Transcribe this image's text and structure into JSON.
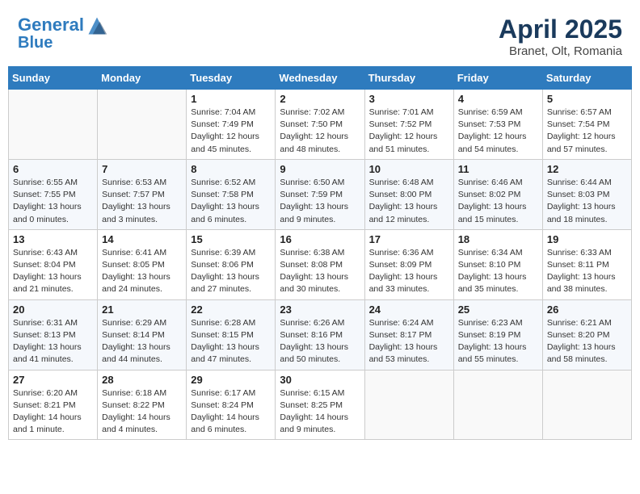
{
  "header": {
    "logo_line1": "General",
    "logo_line2": "Blue",
    "title": "April 2025",
    "subtitle": "Branet, Olt, Romania"
  },
  "days_of_week": [
    "Sunday",
    "Monday",
    "Tuesday",
    "Wednesday",
    "Thursday",
    "Friday",
    "Saturday"
  ],
  "weeks": [
    [
      {
        "day": "",
        "info": ""
      },
      {
        "day": "",
        "info": ""
      },
      {
        "day": "1",
        "info": "Sunrise: 7:04 AM\nSunset: 7:49 PM\nDaylight: 12 hours and 45 minutes."
      },
      {
        "day": "2",
        "info": "Sunrise: 7:02 AM\nSunset: 7:50 PM\nDaylight: 12 hours and 48 minutes."
      },
      {
        "day": "3",
        "info": "Sunrise: 7:01 AM\nSunset: 7:52 PM\nDaylight: 12 hours and 51 minutes."
      },
      {
        "day": "4",
        "info": "Sunrise: 6:59 AM\nSunset: 7:53 PM\nDaylight: 12 hours and 54 minutes."
      },
      {
        "day": "5",
        "info": "Sunrise: 6:57 AM\nSunset: 7:54 PM\nDaylight: 12 hours and 57 minutes."
      }
    ],
    [
      {
        "day": "6",
        "info": "Sunrise: 6:55 AM\nSunset: 7:55 PM\nDaylight: 13 hours and 0 minutes."
      },
      {
        "day": "7",
        "info": "Sunrise: 6:53 AM\nSunset: 7:57 PM\nDaylight: 13 hours and 3 minutes."
      },
      {
        "day": "8",
        "info": "Sunrise: 6:52 AM\nSunset: 7:58 PM\nDaylight: 13 hours and 6 minutes."
      },
      {
        "day": "9",
        "info": "Sunrise: 6:50 AM\nSunset: 7:59 PM\nDaylight: 13 hours and 9 minutes."
      },
      {
        "day": "10",
        "info": "Sunrise: 6:48 AM\nSunset: 8:00 PM\nDaylight: 13 hours and 12 minutes."
      },
      {
        "day": "11",
        "info": "Sunrise: 6:46 AM\nSunset: 8:02 PM\nDaylight: 13 hours and 15 minutes."
      },
      {
        "day": "12",
        "info": "Sunrise: 6:44 AM\nSunset: 8:03 PM\nDaylight: 13 hours and 18 minutes."
      }
    ],
    [
      {
        "day": "13",
        "info": "Sunrise: 6:43 AM\nSunset: 8:04 PM\nDaylight: 13 hours and 21 minutes."
      },
      {
        "day": "14",
        "info": "Sunrise: 6:41 AM\nSunset: 8:05 PM\nDaylight: 13 hours and 24 minutes."
      },
      {
        "day": "15",
        "info": "Sunrise: 6:39 AM\nSunset: 8:06 PM\nDaylight: 13 hours and 27 minutes."
      },
      {
        "day": "16",
        "info": "Sunrise: 6:38 AM\nSunset: 8:08 PM\nDaylight: 13 hours and 30 minutes."
      },
      {
        "day": "17",
        "info": "Sunrise: 6:36 AM\nSunset: 8:09 PM\nDaylight: 13 hours and 33 minutes."
      },
      {
        "day": "18",
        "info": "Sunrise: 6:34 AM\nSunset: 8:10 PM\nDaylight: 13 hours and 35 minutes."
      },
      {
        "day": "19",
        "info": "Sunrise: 6:33 AM\nSunset: 8:11 PM\nDaylight: 13 hours and 38 minutes."
      }
    ],
    [
      {
        "day": "20",
        "info": "Sunrise: 6:31 AM\nSunset: 8:13 PM\nDaylight: 13 hours and 41 minutes."
      },
      {
        "day": "21",
        "info": "Sunrise: 6:29 AM\nSunset: 8:14 PM\nDaylight: 13 hours and 44 minutes."
      },
      {
        "day": "22",
        "info": "Sunrise: 6:28 AM\nSunset: 8:15 PM\nDaylight: 13 hours and 47 minutes."
      },
      {
        "day": "23",
        "info": "Sunrise: 6:26 AM\nSunset: 8:16 PM\nDaylight: 13 hours and 50 minutes."
      },
      {
        "day": "24",
        "info": "Sunrise: 6:24 AM\nSunset: 8:17 PM\nDaylight: 13 hours and 53 minutes."
      },
      {
        "day": "25",
        "info": "Sunrise: 6:23 AM\nSunset: 8:19 PM\nDaylight: 13 hours and 55 minutes."
      },
      {
        "day": "26",
        "info": "Sunrise: 6:21 AM\nSunset: 8:20 PM\nDaylight: 13 hours and 58 minutes."
      }
    ],
    [
      {
        "day": "27",
        "info": "Sunrise: 6:20 AM\nSunset: 8:21 PM\nDaylight: 14 hours and 1 minute."
      },
      {
        "day": "28",
        "info": "Sunrise: 6:18 AM\nSunset: 8:22 PM\nDaylight: 14 hours and 4 minutes."
      },
      {
        "day": "29",
        "info": "Sunrise: 6:17 AM\nSunset: 8:24 PM\nDaylight: 14 hours and 6 minutes."
      },
      {
        "day": "30",
        "info": "Sunrise: 6:15 AM\nSunset: 8:25 PM\nDaylight: 14 hours and 9 minutes."
      },
      {
        "day": "",
        "info": ""
      },
      {
        "day": "",
        "info": ""
      },
      {
        "day": "",
        "info": ""
      }
    ]
  ]
}
